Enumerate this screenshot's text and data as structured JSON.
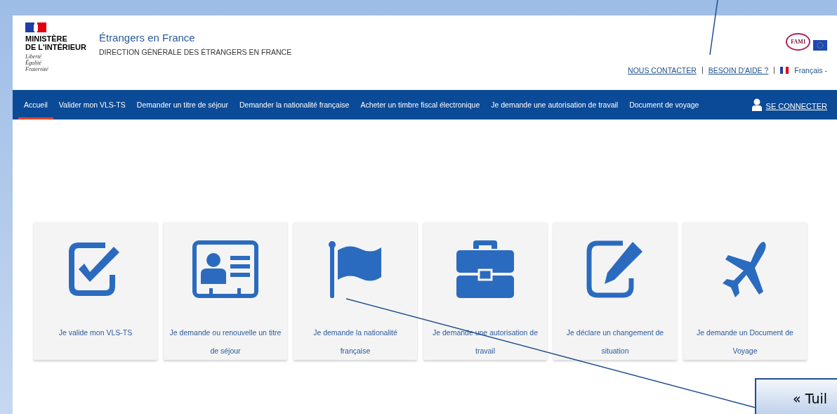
{
  "header": {
    "ministry": "MINISTÈRE\nDE L'INTÉRIEUR",
    "motto": [
      "Liberté",
      "Égalité",
      "Fraternité"
    ],
    "site_title": "Étrangers en France",
    "site_subtitle": "DIRECTION GÉNÉRALE DES ÉTRANGERS EN FRANCE",
    "partner_logo": "FAMI",
    "links": [
      "NOUS CONTACTER",
      "BESOIN D'AIDE ?"
    ],
    "language": "Français -"
  },
  "nav": {
    "items": [
      {
        "label": "Accueil",
        "selected": true
      },
      {
        "label": "Valider mon VLS-TS",
        "selected": false
      },
      {
        "label": "Demander un titre de séjour",
        "selected": false
      },
      {
        "label": "Demander la nationalité française",
        "selected": false
      },
      {
        "label": "Acheter un timbre fiscal électronique",
        "selected": false
      },
      {
        "label": "Je demande une autorisation de travail",
        "selected": false
      },
      {
        "label": "Document de voyage",
        "selected": false
      }
    ],
    "login": "SE CONNECTER"
  },
  "tiles": [
    {
      "kind": "check",
      "label": "Je valide mon VLS-TS"
    },
    {
      "kind": "card",
      "label": "Je demande ou renouvelle un titre de séjour"
    },
    {
      "kind": "flag",
      "label": "Je demande la nationalité française"
    },
    {
      "kind": "briefcase",
      "label": "Je demande une autorisation de travail"
    },
    {
      "kind": "edit",
      "label": "Je déclare un changement de situation"
    },
    {
      "kind": "plane",
      "label": "Je demande un Document de Voyage"
    }
  ],
  "callout": {
    "text": "« Tuil"
  }
}
